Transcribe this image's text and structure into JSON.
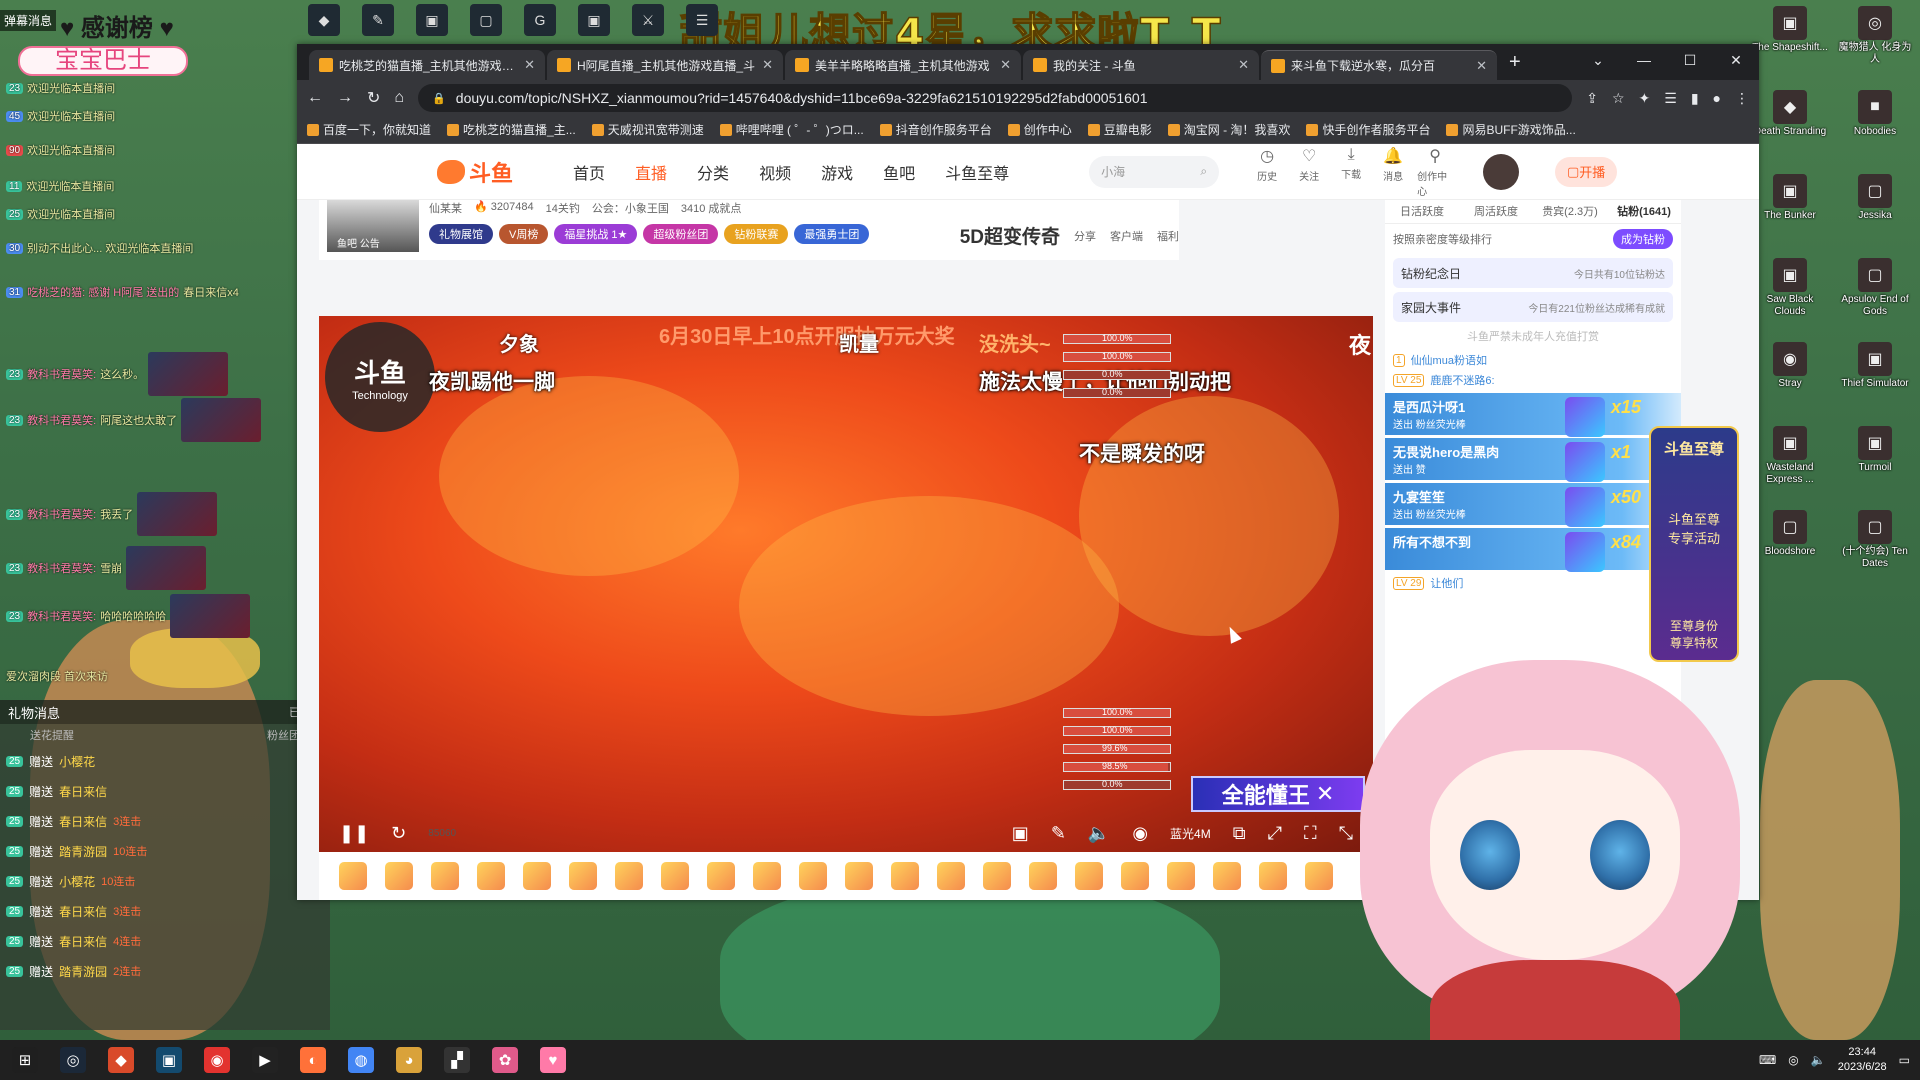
{
  "banner_text": "甜姐儿想过4星，求求啦T_T",
  "left_panel": {
    "title": "弹幕消息",
    "thanks": "感谢榜",
    "baby_bus": "宝宝巴士",
    "chat": [
      {
        "lv": "23",
        "name": "",
        "text": "欢迎光临本直播间",
        "cls": ""
      },
      {
        "lv": "45",
        "name": "",
        "text": "欢迎光临本直播间",
        "cls": "blue"
      },
      {
        "lv": "90",
        "name": "",
        "text": "欢迎光临本直播间",
        "cls": "red"
      },
      {
        "lv": "11",
        "name": "",
        "text": "欢迎光临本直播间",
        "cls": ""
      },
      {
        "lv": "25",
        "name": "",
        "text": "欢迎光临本直播间",
        "cls": ""
      },
      {
        "lv": "30",
        "name": "",
        "text": "别动不出此心... 欢迎光临本直播间",
        "cls": "blue"
      },
      {
        "lv": "31",
        "name": "吃桃芝的猫: 感谢 H阿尾 送出的",
        "text": "春日来信x4",
        "cls": "blue"
      },
      {
        "lv": "23",
        "name": "教科书君莫笑:",
        "text": "这么秒。",
        "cls": ""
      },
      {
        "lv": "23",
        "name": "教科书君莫笑:",
        "text": "阿尾这也太敢了",
        "cls": ""
      },
      {
        "lv": "23",
        "name": "教科书君莫笑:",
        "text": "我丢了",
        "cls": ""
      },
      {
        "lv": "23",
        "name": "教科书君莫笑:",
        "text": "雪崩",
        "cls": ""
      },
      {
        "lv": "23",
        "name": "教科书君莫笑:",
        "text": "哈哈哈哈哈哈",
        "cls": ""
      },
      {
        "lv": "",
        "name": "",
        "text": "爱次溜肉段 首次来访",
        "cls": ""
      }
    ]
  },
  "gift_panel": {
    "title": "礼物消息",
    "locked": "已锁定",
    "sub_left": "粉丝团",
    "sub_right": "送花提醒",
    "rows": [
      {
        "lv": "25",
        "sent": "赠送",
        "gift": "小樱花",
        "combo": ""
      },
      {
        "lv": "25",
        "sent": "赠送",
        "gift": "春日来信",
        "combo": ""
      },
      {
        "lv": "25",
        "sent": "赠送",
        "gift": "春日来信",
        "combo": "3连击"
      },
      {
        "lv": "25",
        "sent": "赠送",
        "gift": "踏青游园",
        "combo": "10连击"
      },
      {
        "lv": "25",
        "sent": "赠送",
        "gift": "小樱花",
        "combo": "10连击"
      },
      {
        "lv": "25",
        "sent": "赠送",
        "gift": "春日来信",
        "combo": "3连击"
      },
      {
        "lv": "25",
        "sent": "赠送",
        "gift": "春日来信",
        "combo": "4连击"
      },
      {
        "lv": "25",
        "sent": "赠送",
        "gift": "踏青游园",
        "combo": "2连击"
      }
    ]
  },
  "browser": {
    "tabs": [
      {
        "label": "吃桃芝的猫直播_主机其他游戏直播",
        "active": false
      },
      {
        "label": "H阿尾直播_主机其他游戏直播_斗",
        "active": false
      },
      {
        "label": "美羊羊略略略直播_主机其他游戏",
        "active": false
      },
      {
        "label": "我的关注 - 斗鱼",
        "active": false
      },
      {
        "label": "来斗鱼下载逆水寒，瓜分百",
        "active": true
      }
    ],
    "url": "douyu.com/topic/NSHXZ_xianmoumou?rid=1457640&dyshid=11bce69a-3229fa621510192295d2fabd00051601",
    "bookmarks": [
      "百度一下，你就知道",
      "吃桃芝的猫直播_主...",
      "天威视讯宽带测速",
      "哔哩哔哩 ( ゜- ゜)つロ...",
      "抖音创作服务平台",
      "创作中心",
      "豆瓣电影",
      "淘宝网 - 淘！我喜欢",
      "快手创作者服务平台",
      "网易BUFF游戏饰品..."
    ]
  },
  "site_nav": {
    "logo": "斗鱼",
    "items": [
      "首页",
      "直播",
      "分类",
      "视频",
      "游戏",
      "鱼吧",
      "斗鱼至尊"
    ],
    "active_index": 1,
    "search_placeholder": "小海",
    "utils": [
      "历史",
      "关注",
      "下载",
      "消息",
      "创作中心"
    ],
    "kaibo": "开播"
  },
  "room": {
    "anchor": "仙某某",
    "avatar_label": "鱼吧  公告",
    "heat": "3207484",
    "fans": "14关钓",
    "guild": "公会：小象王国",
    "fans_count": "3410 成就点",
    "pills": [
      {
        "label": "礼物展馆",
        "color": "#2f3a8c"
      },
      {
        "label": "V周榜",
        "color": "#b8562f"
      },
      {
        "label": "福星挑战 1★",
        "color": "#9b3cd6"
      },
      {
        "label": "超级粉丝团",
        "color": "#c536a6"
      },
      {
        "label": "钻粉联赛",
        "color": "#e8a21f"
      },
      {
        "label": "最强勇士团",
        "color": "#3866d6"
      }
    ],
    "ad": "5D超变传奇",
    "actions": [
      "分享",
      "客户端",
      "福利"
    ]
  },
  "video": {
    "marquee": "6月30日早上10点开服抽万元大奖",
    "scene_label": "夕象",
    "kai_label": "凯量",
    "wash_label": "没洗头~",
    "night_label": "夜",
    "subtitles": [
      "夜凯踢他一脚",
      "施法太慢了，让他们别动把",
      "不是瞬发的呀"
    ],
    "watermark_big": "斗鱼",
    "watermark_small": "Technology",
    "hp": [
      "100.0%",
      "100.0%",
      "0.0%",
      "0.0%",
      "100.0%",
      "100.0%",
      "99.6%",
      "98.5%",
      "0.0%"
    ],
    "allpower": "全能懂王",
    "quality": "蓝光4M",
    "danmaku_count": "85060"
  },
  "chat_col": {
    "rank_tabs": [
      "日活跃度",
      "周活跃度",
      "贵宾(2.3万)",
      "钻粉(1641)"
    ],
    "rank_sub": "按照亲密度等级排行",
    "rank_btn": "成为钻粉",
    "card1_title": "钻粉纪念日",
    "card1_right": "今日共有10位钻粉达",
    "card2_title": "家园大事件",
    "card2_right": "今日有221位粉丝达成稀有成就",
    "guard_note": "斗鱼严禁未成年人充值打赏",
    "msgs": [
      {
        "lvl": "1",
        "user": "仙仙mua粉语如",
        "text": ""
      },
      {
        "lvl": "LV 25",
        "user": "鹿鹿不迷路6:",
        "text": ""
      }
    ],
    "banners": [
      {
        "title": "是西瓜汁呀1",
        "sub": "送出  粉丝荧光棒",
        "count": "x15"
      },
      {
        "title": "无畏说hero是黑肉",
        "sub": "送出  赞",
        "count": "x1"
      },
      {
        "title": "九宴笙笙",
        "sub": "送出  粉丝荧光棒",
        "count": "x50"
      },
      {
        "title": "所有不想不到",
        "sub": "",
        "count": "x84"
      }
    ],
    "lv29": "LV 29",
    "lv29_text": "让他们"
  },
  "supreme_promo": {
    "title": "斗鱼至尊",
    "line1": "斗鱼至尊",
    "line2": "专享活动",
    "line3": "至尊身份",
    "line4": "尊享特权"
  },
  "desktop_icons": [
    {
      "label": "The Shapeshift...",
      "icon": "▣"
    },
    {
      "label": "魔物猎人 化身为人",
      "icon": "◎"
    },
    {
      "label": "Death Stranding",
      "icon": "◆"
    },
    {
      "label": "Nobodies",
      "icon": "■"
    },
    {
      "label": "The Bunker",
      "icon": "▣"
    },
    {
      "label": "Jessika",
      "icon": "▢"
    },
    {
      "label": "Saw Black Clouds",
      "icon": "▣"
    },
    {
      "label": "Apsulov End of Gods",
      "icon": "▢"
    },
    {
      "label": "Stray",
      "icon": "◉"
    },
    {
      "label": "Thief Simulator",
      "icon": "▣"
    },
    {
      "label": "Wasteland Express ...",
      "icon": "▣"
    },
    {
      "label": "Turmoil",
      "icon": "▣"
    },
    {
      "label": "Bloodshore",
      "icon": "▢"
    },
    {
      "label": "(十个约会) Ten Dates",
      "icon": "▢"
    }
  ],
  "taskbar": {
    "time": "23:44",
    "date": "2023/6/28",
    "icons": [
      "windows-logo",
      "steam",
      "game",
      "app",
      "netease",
      "media",
      "firefox",
      "chrome",
      "owl",
      "unity",
      "pink-app",
      "heart-app"
    ]
  },
  "colors": {
    "douyu_orange": "#ff5d23",
    "banner_yellow": "#f5e64a"
  }
}
